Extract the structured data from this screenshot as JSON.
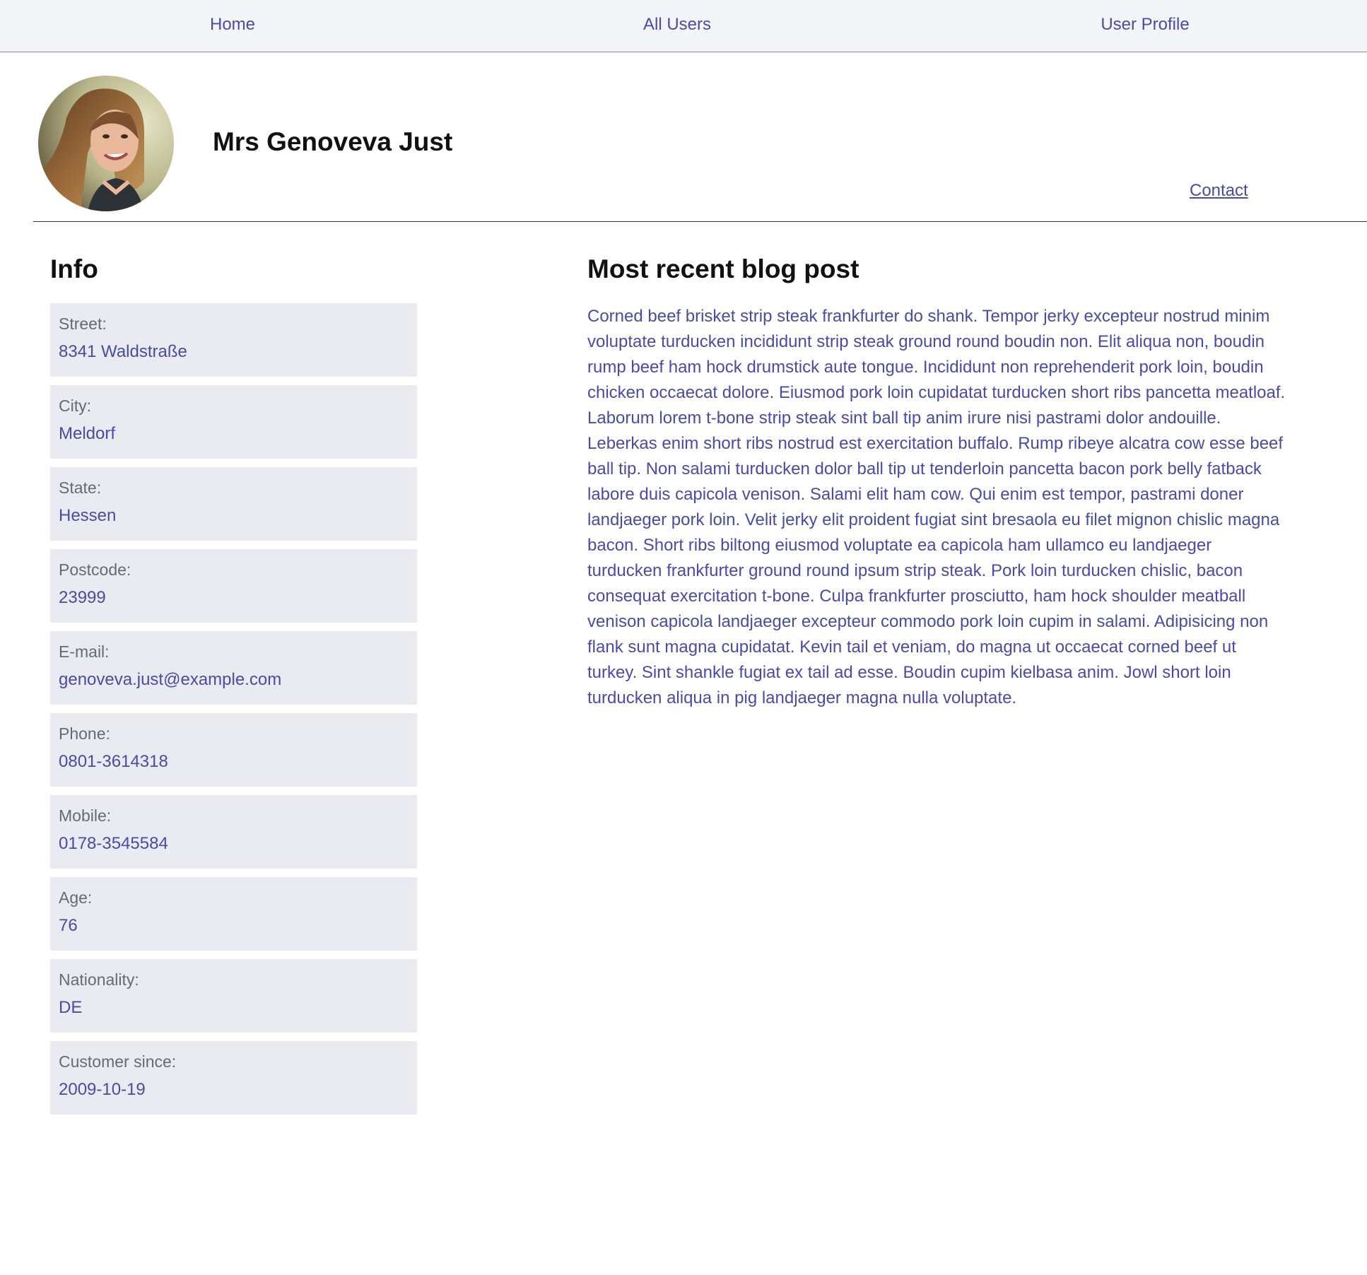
{
  "nav": {
    "home": "Home",
    "all_users": "All Users",
    "user_profile": "User Profile"
  },
  "profile": {
    "name": "Mrs Genoveva Just",
    "contact": "Contact"
  },
  "info": {
    "heading": "Info",
    "fields": [
      {
        "label": "Street:",
        "value": "8341 Waldstraße"
      },
      {
        "label": "City:",
        "value": "Meldorf"
      },
      {
        "label": "State:",
        "value": "Hessen"
      },
      {
        "label": "Postcode:",
        "value": "23999"
      },
      {
        "label": "E-mail:",
        "value": "genoveva.just@example.com"
      },
      {
        "label": "Phone:",
        "value": "0801-3614318"
      },
      {
        "label": "Mobile:",
        "value": "0178-3545584"
      },
      {
        "label": "Age:",
        "value": "76"
      },
      {
        "label": "Nationality:",
        "value": "DE"
      },
      {
        "label": "Customer since:",
        "value": "2009-10-19"
      }
    ]
  },
  "blog": {
    "heading": "Most recent blog post",
    "body": "Corned beef brisket strip steak frankfurter do shank. Tempor jerky excepteur nostrud minim voluptate turducken incididunt strip steak ground round boudin non. Elit aliqua non, boudin rump beef ham hock drumstick aute tongue. Incididunt non reprehenderit pork loin, boudin chicken occaecat dolore. Eiusmod pork loin cupidatat turducken short ribs pancetta meatloaf. Laborum lorem t-bone strip steak sint ball tip anim irure nisi pastrami dolor andouille. Leberkas enim short ribs nostrud est exercitation buffalo. Rump ribeye alcatra cow esse beef ball tip. Non salami turducken dolor ball tip ut tenderloin pancetta bacon pork belly fatback labore duis capicola venison. Salami elit ham cow. Qui enim est tempor, pastrami doner landjaeger pork loin. Velit jerky elit proident fugiat sint bresaola eu filet mignon chislic magna bacon. Short ribs biltong eiusmod voluptate ea capicola ham ullamco eu landjaeger turducken frankfurter ground round ipsum strip steak. Pork loin turducken chislic, bacon consequat exercitation t-bone. Culpa frankfurter prosciutto, ham hock shoulder meatball venison capicola landjaeger excepteur commodo pork loin cupim in salami. Adipisicing non flank sunt magna cupidatat. Kevin tail et veniam, do magna ut occaecat corned beef ut turkey. Sint shankle fugiat ex tail ad esse. Boudin cupim kielbasa anim. Jowl short loin turducken aliqua in pig landjaeger magna nulla voluptate."
  },
  "colors": {
    "accent": "#4a4aa8",
    "nav_bg": "#f4f5f9",
    "card_bg": "#eaebf0",
    "label": "#666a73"
  }
}
